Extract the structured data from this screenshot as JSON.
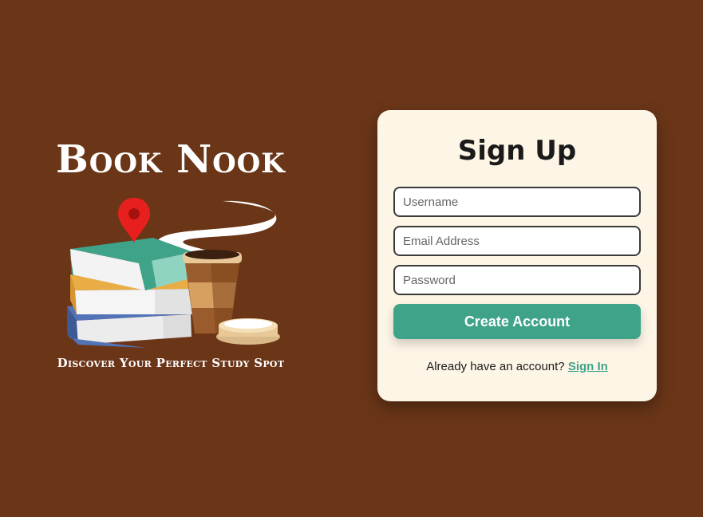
{
  "brand": {
    "title": "Book Nook",
    "tagline": "Discover Your Perfect Study Spot",
    "illustration": "books-coffee-location-pin-illustration"
  },
  "signup": {
    "title": "Sign Up",
    "username_placeholder": "Username",
    "email_placeholder": "Email Address",
    "password_placeholder": "Password",
    "submit_label": "Create Account",
    "signin_prompt": "Already have an account?",
    "signin_link": "Sign In"
  },
  "colors": {
    "background": "#6b3618",
    "card": "#fdf5e6",
    "accent": "#3fa38a",
    "pin": "#e8201d"
  }
}
